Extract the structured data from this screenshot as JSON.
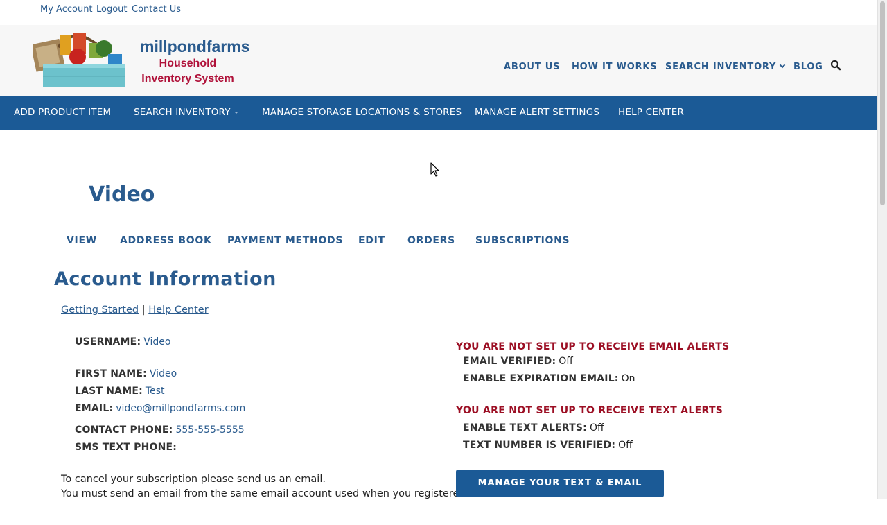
{
  "utility_links": [
    "My Account",
    "Logout",
    "Contact Us"
  ],
  "brand": {
    "name": "millpondfarms",
    "subtitle_line1": "Household",
    "subtitle_line2": "Inventory System"
  },
  "top_nav": [
    "ABOUT US",
    "HOW IT WORKS",
    "SEARCH INVENTORY",
    "BLOG"
  ],
  "main_nav": [
    "ADD PRODUCT ITEM",
    "SEARCH INVENTORY",
    "MANAGE STORAGE LOCATIONS & STORES",
    "MANAGE ALERT SETTINGS",
    "HELP CENTER"
  ],
  "page_title": "Video",
  "tabs": [
    "VIEW",
    "ADDRESS BOOK",
    "PAYMENT METHODS",
    "EDIT",
    "ORDERS",
    "SUBSCRIPTIONS"
  ],
  "section_title": "Account Information",
  "help_links": {
    "getting_started": "Getting Started",
    "separator": "|",
    "help_center": "Help Center"
  },
  "account": {
    "username_label": "USERNAME:",
    "username": "Video",
    "first_name_label": "FIRST NAME:",
    "first_name": "Video",
    "last_name_label": "LAST NAME:",
    "last_name": "Test",
    "email_label": "EMAIL:",
    "email": "video@millpondfarms.com",
    "contact_phone_label": "CONTACT PHONE:",
    "contact_phone": "555-555-5555",
    "sms_phone_label": "SMS TEXT PHONE:",
    "sms_phone": ""
  },
  "notes": [
    "To cancel your subscription please send us an email.",
    "You must send an email from the same email account used when you registered."
  ],
  "email_alerts": {
    "heading": "YOU ARE NOT SET UP TO RECEIVE EMAIL ALERTS",
    "verified_label": "EMAIL VERIFIED:",
    "verified": "Off",
    "expiration_label": "ENABLE EXPIRATION EMAIL:",
    "expiration": "On"
  },
  "text_alerts": {
    "heading": "YOU ARE NOT SET UP TO RECEIVE TEXT ALERTS",
    "enable_label": "ENABLE TEXT ALERTS:",
    "enable": "Off",
    "verified_label": "TEXT NUMBER IS VERIFIED:",
    "verified": "Off"
  },
  "manage_alerts_button": "MANAGE YOUR TEXT & EMAIL ALERTS",
  "colors": {
    "brand_blue": "#2a5b8e",
    "nav_blue": "#1b5a96",
    "alert_red": "#9c0f24",
    "brand_red": "#b0123a"
  }
}
